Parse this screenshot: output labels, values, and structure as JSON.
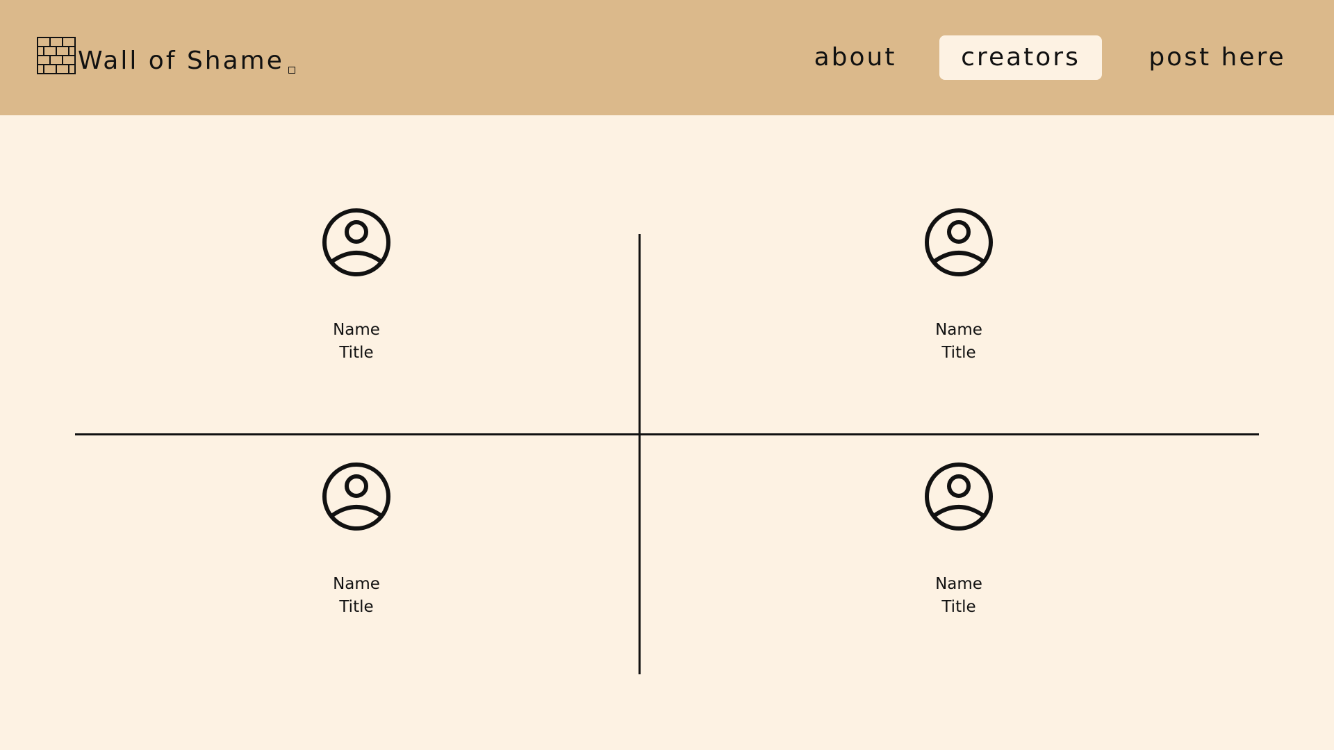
{
  "brand": {
    "title": "Wall of Shame",
    "icon": "brick-wall-icon"
  },
  "nav": {
    "items": [
      {
        "label": "about",
        "active": false
      },
      {
        "label": "creators",
        "active": true
      },
      {
        "label": "post here",
        "active": false
      }
    ]
  },
  "creators": [
    {
      "name": "Name",
      "title": "Title",
      "icon": "user-avatar-icon"
    },
    {
      "name": "Name",
      "title": "Title",
      "icon": "user-avatar-icon"
    },
    {
      "name": "Name",
      "title": "Title",
      "icon": "user-avatar-icon"
    },
    {
      "name": "Name",
      "title": "Title",
      "icon": "user-avatar-icon"
    }
  ],
  "colors": {
    "header_bg": "#dbb98b",
    "page_bg": "#fdf2e3",
    "active_tab_bg": "#fdf2e3",
    "ink": "#111111"
  }
}
